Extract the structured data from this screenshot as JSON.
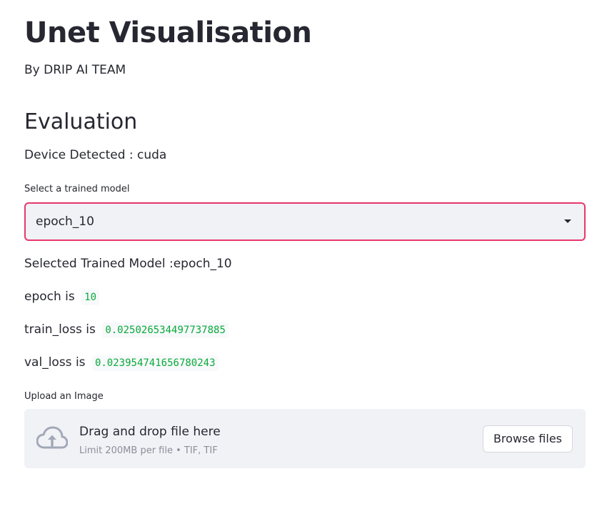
{
  "header": {
    "title": "Unet Visualisation",
    "byline": "By DRIP AI TEAM"
  },
  "evaluation": {
    "heading": "Evaluation",
    "device_text": "Device Detected : cuda",
    "model_select": {
      "label": "Select a trained model",
      "selected_value": "epoch_10"
    },
    "selected_model_text": "Selected Trained Model :epoch_10",
    "stats": [
      {
        "label": "epoch is",
        "value": "10"
      },
      {
        "label": "train_loss is",
        "value": "0.025026534497737885"
      },
      {
        "label": "val_loss is",
        "value": "0.023954741656780243"
      }
    ]
  },
  "uploader": {
    "label": "Upload an Image",
    "drop_text": "Drag and drop file here",
    "limit_text": "Limit 200MB per file • TIF, TIF",
    "browse_label": "Browse files",
    "icon": "cloud-upload-icon"
  },
  "colors": {
    "accent": "#e8386b",
    "code_text": "#09ab3b",
    "panel_bg": "#f0f2f6",
    "text": "#262730"
  }
}
